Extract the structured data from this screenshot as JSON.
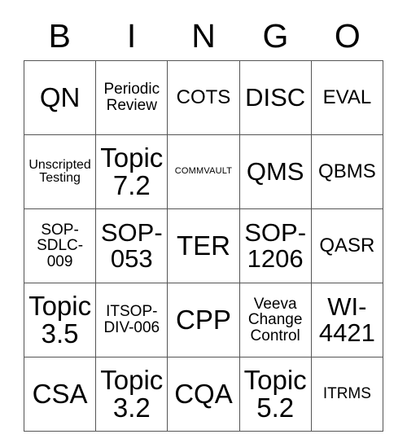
{
  "card": {
    "headers": [
      "B",
      "I",
      "N",
      "G",
      "O"
    ],
    "rows": [
      [
        {
          "text": "QN",
          "size": "fs-xl"
        },
        {
          "text": "Periodic Review",
          "size": "fs-sm"
        },
        {
          "text": "COTS",
          "size": "fs-md"
        },
        {
          "text": "DISC",
          "size": "fs-lg"
        },
        {
          "text": "EVAL",
          "size": "fs-md"
        }
      ],
      [
        {
          "text": "Unscripted Testing",
          "size": "fs-xs"
        },
        {
          "text": "Topic 7.2",
          "size": "fs-xl"
        },
        {
          "text": "COMMVAULT",
          "size": "fs-xxs"
        },
        {
          "text": "QMS",
          "size": "fs-lg"
        },
        {
          "text": "QBMS",
          "size": "fs-md"
        }
      ],
      [
        {
          "text": "SOP-SDLC-009",
          "size": "fs-sm"
        },
        {
          "text": "SOP-053",
          "size": "fs-lg"
        },
        {
          "text": "TER",
          "size": "fs-xl"
        },
        {
          "text": "SOP-1206",
          "size": "fs-lg"
        },
        {
          "text": "QASR",
          "size": "fs-md"
        }
      ],
      [
        {
          "text": "Topic 3.5",
          "size": "fs-xl"
        },
        {
          "text": "ITSOP-DIV-006",
          "size": "fs-sm"
        },
        {
          "text": "CPP",
          "size": "fs-xl"
        },
        {
          "text": "Veeva Change Control",
          "size": "fs-sm"
        },
        {
          "text": "WI-4421",
          "size": "fs-lg"
        }
      ],
      [
        {
          "text": "CSA",
          "size": "fs-xl"
        },
        {
          "text": "Topic 3.2",
          "size": "fs-xl"
        },
        {
          "text": "CQA",
          "size": "fs-xl"
        },
        {
          "text": "Topic 5.2",
          "size": "fs-xl"
        },
        {
          "text": "ITRMS",
          "size": "fs-sm"
        }
      ]
    ]
  },
  "colors": {
    "border": "#555555",
    "text": "#000000",
    "background": "#ffffff"
  }
}
